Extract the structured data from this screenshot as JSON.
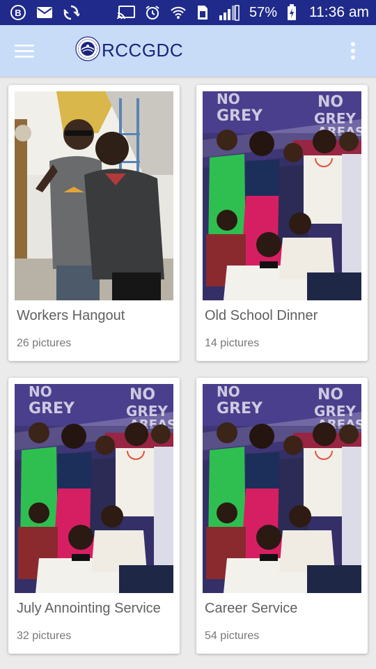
{
  "status_bar": {
    "battery_percent": "57%",
    "time": "11:36 am"
  },
  "app_bar": {
    "title": "RCCGDC"
  },
  "albums": [
    {
      "title": "Workers Hangout",
      "count": "26 pictures"
    },
    {
      "title": "Old School Dinner",
      "count": "14 pictures"
    },
    {
      "title": "July Annointing Service",
      "count": "32 pictures"
    },
    {
      "title": "Career Service",
      "count": "54 pictures"
    }
  ],
  "colors": {
    "status_bar_bg": "#1f2a8a",
    "app_bar_bg": "#c8dcf8",
    "title_color": "#1a237e",
    "background": "#ebebeb"
  }
}
